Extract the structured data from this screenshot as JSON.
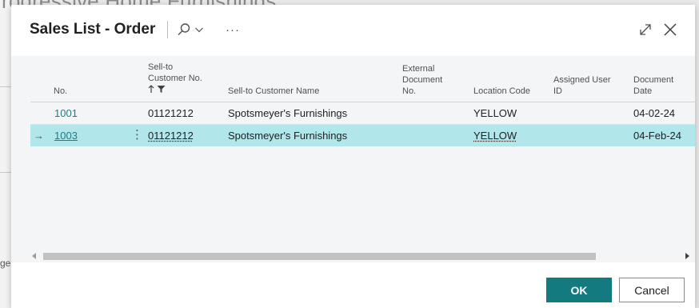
{
  "background": {
    "title_fragment": "rogressive Home Furnishings",
    "side_fragment": "ge"
  },
  "dialog": {
    "title": "Sales List - Order",
    "search_icon": "search-icon",
    "more_label": "···",
    "expand_icon": "expand-icon",
    "close_icon": "close-icon"
  },
  "columns": {
    "no": "No.",
    "sell_to_no_l1": "Sell-to",
    "sell_to_no_l2": "Customer No.",
    "sell_to_name": "Sell-to Customer Name",
    "ext_doc_l1": "External",
    "ext_doc_l2": "Document",
    "ext_doc_l3": "No.",
    "location": "Location Code",
    "assigned_l1": "Assigned User",
    "assigned_l2": "ID",
    "doc_date_l1": "Document",
    "doc_date_l2": "Date"
  },
  "rows": [
    {
      "no": "1001",
      "cust_no": "01121212",
      "cust_name": "Spotsmeyer's Furnishings",
      "ext_doc": "",
      "location": "YELLOW",
      "assigned": "",
      "doc_date": "04-02-24"
    },
    {
      "no": "1003",
      "cust_no": "01121212",
      "cust_name": "Spotsmeyer's Furnishings",
      "ext_doc": "",
      "location": "YELLOW",
      "assigned": "",
      "doc_date": "04-Feb-24",
      "selected": true
    }
  ],
  "row_indicator": "→",
  "row_menu": "⋮",
  "buttons": {
    "ok": "OK",
    "cancel": "Cancel"
  },
  "colors": {
    "accent": "#137b80",
    "selected_row": "#b1e6ea",
    "link": "#1a7f86"
  }
}
